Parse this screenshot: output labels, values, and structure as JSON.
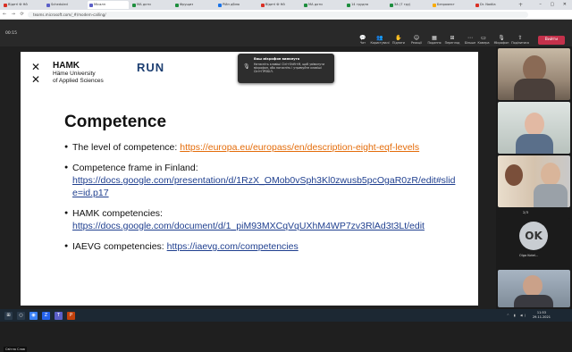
{
  "browser": {
    "tabs": [
      {
        "label": "Відеті Ф Нй",
        "active": false,
        "color": "#d93025"
      },
      {
        "label": "Scheduled",
        "active": false,
        "color": "#5b5fc7"
      },
      {
        "label": "Miсалн",
        "active": true,
        "color": "#5b5fc7"
      },
      {
        "label": "МА дхти",
        "active": false,
        "color": "#1e8e3e"
      },
      {
        "label": "Фрущиз",
        "active": false,
        "color": "#1e8e3e"
      },
      {
        "label": "Рiйн дблю",
        "active": false,
        "color": "#1a73e8"
      },
      {
        "label": "Відеті Ф Нй",
        "active": false,
        "color": "#d93025"
      },
      {
        "label": "МА дхти",
        "active": false,
        "color": "#1e8e3e"
      },
      {
        "label": "14 грудня",
        "active": false,
        "color": "#1e8e3e"
      },
      {
        "label": "ЗА (7 гру)",
        "active": false,
        "color": "#1e8e3e"
      },
      {
        "label": "Безрояект",
        "active": false,
        "color": "#f9ab00"
      },
      {
        "label": "Dr. Nadiia",
        "active": false,
        "color": "#d93025"
      }
    ],
    "url": "teams.microsoft.com/_#/modern-calling/"
  },
  "meeting": {
    "timer": "00:15",
    "controls": [
      {
        "icon": "💬",
        "label": "Чат"
      },
      {
        "icon": "👥",
        "label": "Користувачі",
        "badge": "12"
      },
      {
        "icon": "✋",
        "label": "Підняти"
      },
      {
        "icon": "☺",
        "label": "Реакції"
      },
      {
        "icon": "▦",
        "label": "Подання"
      },
      {
        "icon": "⊞",
        "label": "Перегляд"
      },
      {
        "icon": "⋯",
        "label": "Більше"
      },
      {
        "icon": "▭",
        "label": "Камера"
      },
      {
        "icon": "🎙",
        "label": "Мікрофон"
      },
      {
        "icon": "⇧",
        "label": "Поділитися"
      }
    ],
    "leave_label": "Вийти",
    "toast": {
      "title": "Ваш мікрофон вимкнуто",
      "message": "Натисніть клавіші Ctrl+Shift+M, щоб увімкнути мікрофон, або натисніть і утримуйте клавіші Ctrl+ПРОБІЛ."
    },
    "presenter_name": "Світла Слав"
  },
  "slide": {
    "brand_name": "HAMK",
    "brand_sub1": "Häme University",
    "brand_sub2": "of Applied Sciences",
    "run_logo": "RUN",
    "run_text": "REGIONAL UNIVERSITY NETWORK EUROPEAN UNIVERSITY",
    "title": "Competence",
    "bullets": {
      "b1_text": "The level of competence: ",
      "b1_link": "https://europa.eu/europass/en/description-eight-eqf-levels",
      "b2_text": "Competence frame in Finland:",
      "b2_link": "https://docs.google.com/presentation/d/1RzX_OMob0vSph3Kl0zwusb5pcOgaR0zR/edit#slide=id.p17",
      "b3_text": "HAMK competencies:",
      "b3_link": "https://docs.google.com/document/d/1_piM93MXCqVqUXhM4WP7zv3RlAd3t3Lt/edit",
      "b4_text": "IAEVG competencies: ",
      "b4_link": "https://iaevg.com/competencies"
    }
  },
  "participants": {
    "pager": "2/3",
    "ok_initials": "OK",
    "ok_name": "Olga Kotel..."
  },
  "taskbar": {
    "time": "11:53",
    "date": "29.11.2021"
  }
}
